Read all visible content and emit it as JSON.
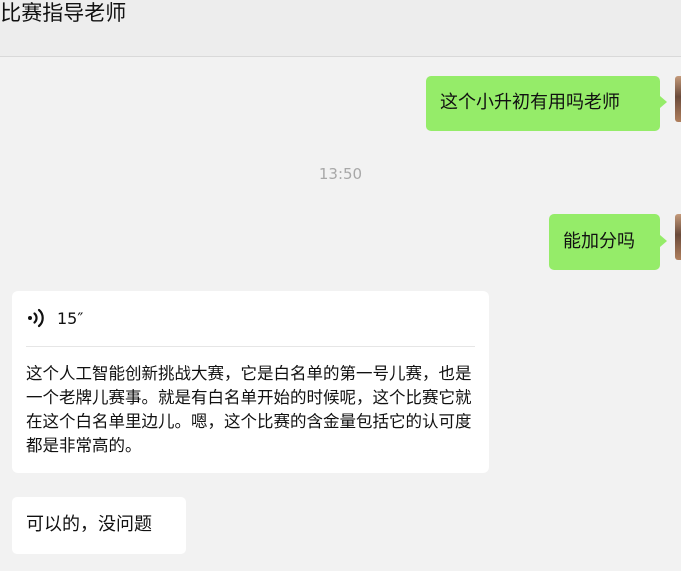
{
  "header": {
    "title": "J比赛指导老师"
  },
  "messages": {
    "out_1": "这个小升初有用吗老师",
    "timestamp": "13:50",
    "out_2": "能加分吗",
    "voice": {
      "icon": "voice-wave-icon",
      "duration": "15″",
      "transcript": "这个人工智能创新挑战大赛，它是白名单的第一号儿赛，也是一个老牌儿赛事。就是有白名单开始的时候呢，这个比赛它就在这个白名单里边儿。嗯，这个比赛的含金量包括它的认可度都是非常高的。"
    },
    "in_1": "可以的，没问题"
  },
  "colors": {
    "outgoing_bubble": "#95ec69",
    "incoming_bubble": "#ffffff",
    "background": "#f2f2f2",
    "timestamp": "#a8a8a8"
  }
}
